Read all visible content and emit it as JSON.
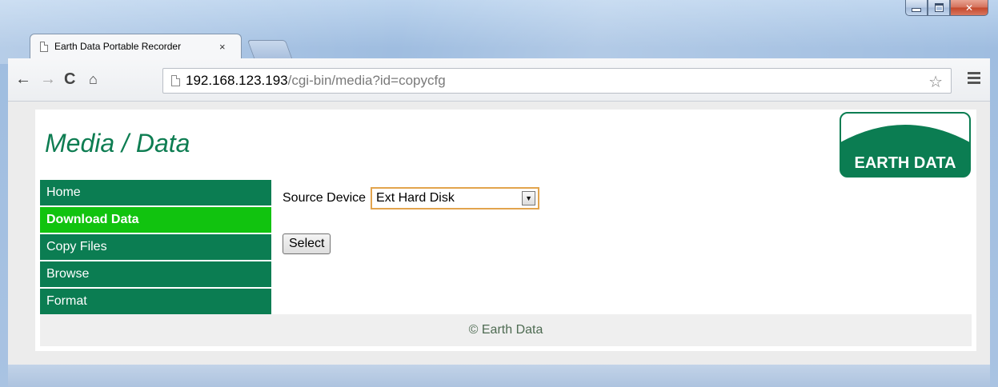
{
  "browser": {
    "tab_title": "Earth Data Portable Recorder",
    "tab_close": "×",
    "url_host": "192.168.123.193",
    "url_path": "/cgi-bin/media?id=copycfg",
    "nav": {
      "back": "←",
      "forward": "→",
      "reload": "C",
      "home": "⌂"
    },
    "bookmark_star": "☆"
  },
  "page": {
    "title": "Media / Data",
    "logo_text": "EARTH DATA",
    "brand_colors": {
      "primary_green": "#0b7d52",
      "active_green": "#11c30f"
    },
    "sidebar": {
      "items": [
        {
          "label": "Home",
          "active": false
        },
        {
          "label": "Download Data",
          "active": true
        },
        {
          "label": "Copy Files",
          "active": false
        },
        {
          "label": "Browse",
          "active": false
        },
        {
          "label": "Format",
          "active": false
        }
      ]
    },
    "form": {
      "source_label": "Source Device",
      "source_value": "Ext Hard Disk",
      "select_button": "Select"
    },
    "footer": "© Earth Data"
  }
}
